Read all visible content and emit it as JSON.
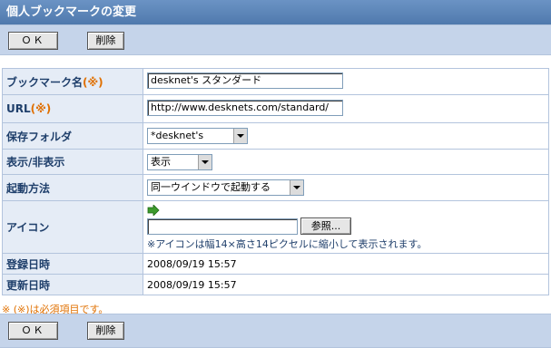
{
  "title": "個人ブックマークの変更",
  "toolbar": {
    "ok_label": "ＯＫ",
    "delete_label": "削除"
  },
  "fields": {
    "bookmark_name": {
      "label": "ブックマーク名",
      "required_mark": "(※)",
      "value": "desknet's スタンダード"
    },
    "url": {
      "label": "URL",
      "required_mark": "(※)",
      "value": "http://www.desknets.com/standard/"
    },
    "folder": {
      "label": "保存フォルダ",
      "selected": "*desknet's"
    },
    "visibility": {
      "label": "表示/非表示",
      "selected": "表示"
    },
    "launch": {
      "label": "起動方法",
      "selected": "同一ウインドウで起動する"
    },
    "icon": {
      "label": "アイコン",
      "file_value": "",
      "browse_label": "参照...",
      "note": "※アイコンは幅14×高さ14ピクセルに縮小して表示されます。"
    },
    "registered": {
      "label": "登録日時",
      "value": "2008/09/19 15:57"
    },
    "updated": {
      "label": "更新日時",
      "value": "2008/09/19 15:57"
    }
  },
  "footnote": "※ (※)は必須項目です。",
  "colors": {
    "title_bar": "#4f79ad",
    "toolbar": "#c5d4ea",
    "label_bg": "#e5ecf6",
    "label_text": "#1f3f6b",
    "required": "#e07000"
  }
}
